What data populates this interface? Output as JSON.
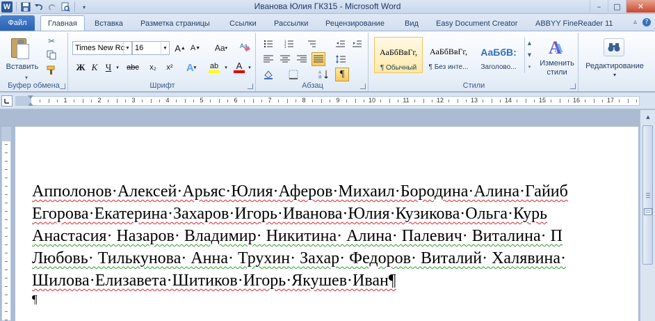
{
  "window": {
    "title": "Иванова Юлия ГК315  -  Microsoft Word",
    "controls": {
      "minimize": "–",
      "maximize": "□",
      "close": "✕"
    }
  },
  "qat": {
    "word_icon": "W",
    "save_icon": "save-icon",
    "undo_icon": "undo-icon",
    "redo_icon": "redo-icon",
    "print_preview_icon": "print-preview-icon",
    "customize_icon": "chevron-down-icon"
  },
  "tabs": {
    "file": "Файл",
    "items": [
      "Главная",
      "Вставка",
      "Разметка страницы",
      "Ссылки",
      "Рассылки",
      "Рецензирование",
      "Вид",
      "Easy Document Creator",
      "ABBYY FineReader 11"
    ],
    "active_index": 0
  },
  "ribbon": {
    "clipboard": {
      "label": "Буфер обмена",
      "paste_label": "Вставить"
    },
    "font": {
      "label": "Шрифт",
      "font_name": "Times New Rc",
      "font_size": "16",
      "grow": "A",
      "shrink": "A",
      "case": "Aa",
      "bold": "Ж",
      "italic": "К",
      "underline": "Ч",
      "strike": "abc",
      "subscript": "x₂",
      "superscript": "x²",
      "effects": "A",
      "highlight": "ab",
      "color": "A"
    },
    "paragraph": {
      "label": "Абзац",
      "show_marks": "¶"
    },
    "styles": {
      "label": "Стили",
      "items": [
        {
          "sample": "АаБбВвГг,",
          "name": "¶ Обычный"
        },
        {
          "sample": "АаБбВвГг,",
          "name": "¶ Без инте..."
        },
        {
          "sample": "АаБбВ:",
          "name": "Заголово..."
        }
      ],
      "change_styles": "Изменить стили"
    },
    "editing": {
      "label": "Редактирование"
    }
  },
  "ruler": {
    "numbers": [
      "1",
      "1",
      "2",
      "3",
      "4",
      "5",
      "6",
      "7",
      "8",
      "9",
      "10",
      "11",
      "12",
      "13",
      "14",
      "15",
      "16",
      "17"
    ]
  },
  "document": {
    "lines": [
      "Апполонов·Алексей·Арьяс·Юлия·Аферов·Михаил·Бородина·Алина·Гайиб",
      "Егорова·Екатерина·Захаров·Игорь·Иванова·Юлия·Кузикова·Ольга·Курь",
      "Анастасия·  Назаров·  Владимир·  Никитина·  Алина·  Палевич·  Виталина·  П",
      "Любовь·  Тилькунова·  Анна·  Трухин·  Захар·  Федоров·  Виталий·  Халявина·",
      "Шилова·Елизавета·Шитиков·Игорь·Якушев·Иван¶"
    ],
    "empty_paragraph": "¶"
  }
}
